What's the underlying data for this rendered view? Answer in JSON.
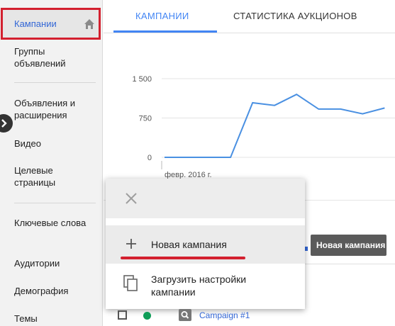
{
  "sidebar": {
    "active": "Кампании",
    "items": [
      "Группы объявлений",
      "Объявления и расширения",
      "Видео",
      "Целевые страницы",
      "Ключевые слова",
      "Аудитории",
      "Демография",
      "Темы"
    ]
  },
  "tabs": [
    "КАМПАНИИ",
    "СТАТИСТИКА АУКЦИОНОВ"
  ],
  "chart_data": {
    "type": "line",
    "x": [
      0,
      1,
      2,
      3,
      4,
      5,
      6,
      7,
      8,
      9,
      10
    ],
    "values": [
      0,
      0,
      0,
      0,
      1040,
      990,
      1200,
      920,
      920,
      830,
      940
    ],
    "ylim": [
      0,
      1500
    ],
    "yticks": [
      "0",
      "750",
      "1 500"
    ],
    "xtick_label": "февр. 2016 г.",
    "line_color": "#4a90e2"
  },
  "popup": {
    "new_campaign": "Новая кампания",
    "upload_settings": "Загрузить настройки кампании"
  },
  "tooltip": "Новая кампания",
  "table": {
    "campaign_link": "Campaign #1",
    "status_color": "#0f9d58"
  }
}
